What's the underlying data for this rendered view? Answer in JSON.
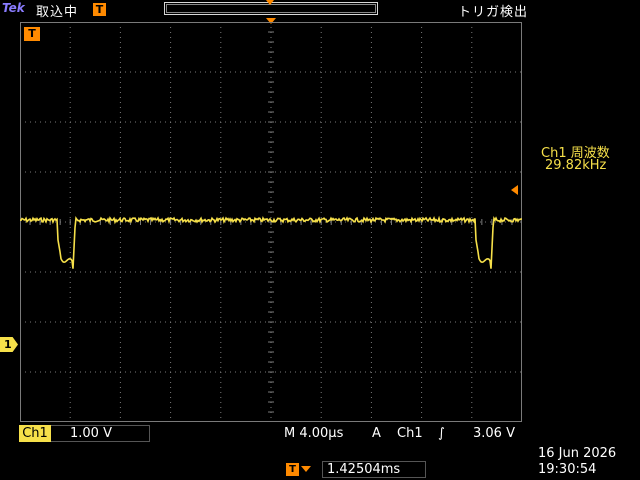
{
  "top": {
    "brand": "Tek",
    "acq_status": "取込中",
    "trigger_position_icon": "T",
    "trigger_status": "トリガ検出"
  },
  "markers": {
    "trigger_time_marker": "T",
    "ch1_ground_marker": "1"
  },
  "measurement": {
    "title": "Ch1 周波数",
    "value": "29.82kHz"
  },
  "bottom": {
    "ch1_label": "Ch1",
    "ch1_scale": "1.00 V",
    "timebase": "M 4.00µs",
    "trigger_mode": "A",
    "trigger_source": "Ch1",
    "trigger_slope": "∫",
    "trigger_level": "3.06 V",
    "position_icon": "T",
    "horizontal_position": "1.42504ms"
  },
  "clock": {
    "date": "16 Jun  2026",
    "time": "19:30:54"
  },
  "colors": {
    "trace": "#f6e04a",
    "graticule": "#7a7a7a",
    "accent": "#ff8a00"
  }
}
